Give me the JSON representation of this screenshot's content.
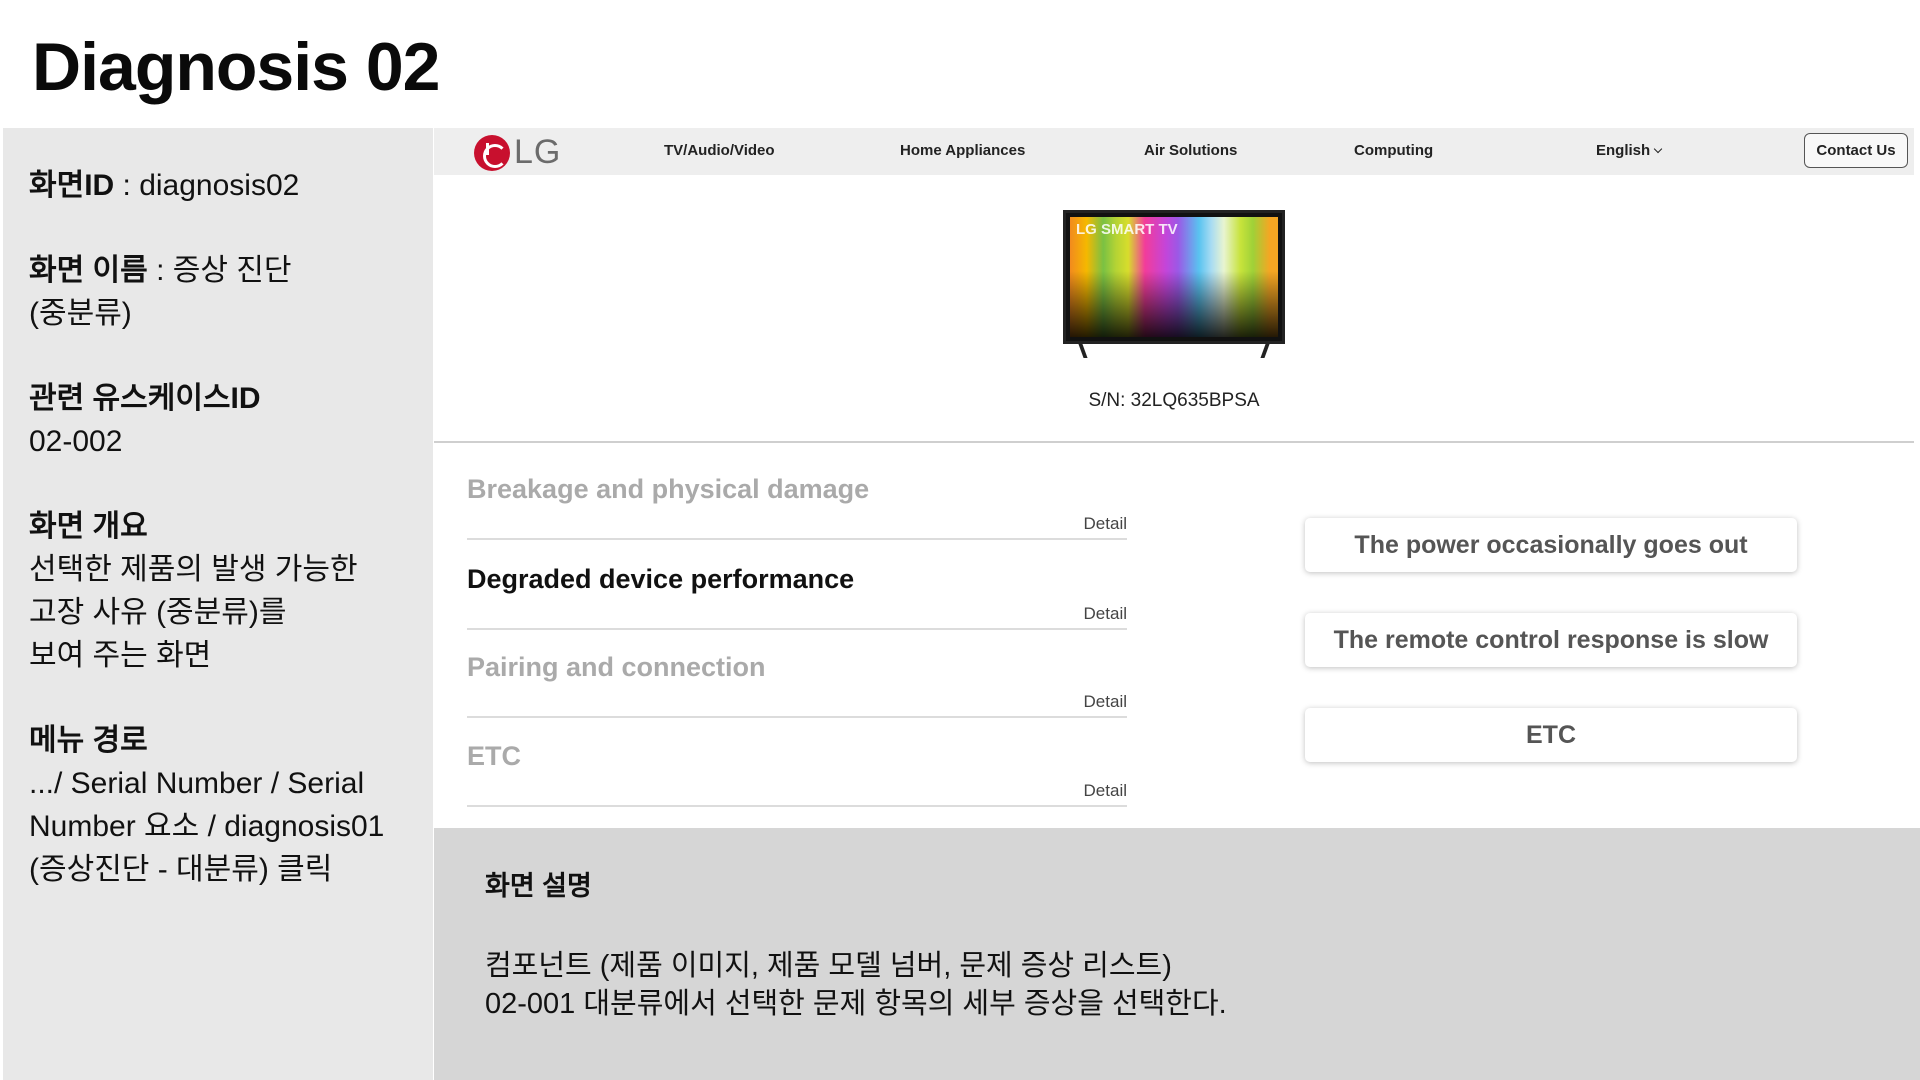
{
  "slide_title": "Diagnosis 02",
  "info": {
    "screen_id_label": "화면ID",
    "screen_id_value": " : diagnosis02",
    "screen_name_label": "화면 이름",
    "screen_name_value": " : 증상 진단",
    "screen_name_value2": "(중분류)",
    "usecase_label": "관련 유스케이스ID",
    "usecase_value": "02-002",
    "overview_label": "화면 개요",
    "overview_lines": [
      "선택한 제품의 발생 가능한",
      "고장 사유 (중분류)를",
      "보여 주는 화면"
    ],
    "menu_path_label": "메뉴 경로",
    "menu_path_lines": [
      ".../ Serial Number / Serial",
      "Number 요소 / diagnosis01",
      "(증상진단 - 대분류) 클릭"
    ]
  },
  "nav": {
    "logo_text": "LG",
    "items": [
      "TV/Audio/Video",
      "Home Appliances",
      "Air Solutions",
      "Computing"
    ],
    "language": "English",
    "contact_label": "Contact Us"
  },
  "product": {
    "tv_screen_text": "LG SMART TV",
    "serial_text": "S/N: 32LQ635BPSA"
  },
  "categories": [
    {
      "title": "Breakage and physical damage",
      "detail": "Detail",
      "active": false
    },
    {
      "title": "Degraded device performance",
      "detail": "Detail",
      "active": true
    },
    {
      "title": "Pairing and connection",
      "detail": "Detail",
      "active": false
    },
    {
      "title": "ETC",
      "detail": "Detail",
      "active": false
    }
  ],
  "symptoms": [
    "The power occasionally goes out",
    "The remote control response is slow",
    "ETC"
  ],
  "description": {
    "title": "화면 설명",
    "lines": [
      "컴포넌트 (제품 이미지, 제품 모델 넘버, 문제 증상 리스트)",
      "02-001 대분류에서 선택한 문제 항목의 세부 증상을 선택한다."
    ]
  },
  "colors": {
    "brand_red": "#c8102e",
    "panel_gray": "#e8e8e8",
    "description_gray": "#d6d6d6",
    "inactive_text": "#aaaaaa"
  }
}
